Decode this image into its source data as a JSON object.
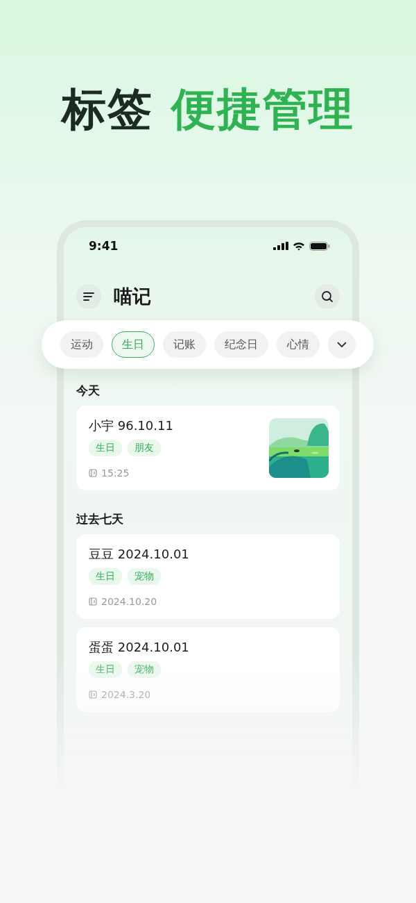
{
  "headline": [
    {
      "text": "标签",
      "kind": "dark"
    },
    {
      "text": "便捷管理",
      "kind": "accent"
    }
  ],
  "status_bar": {
    "time": "9:41"
  },
  "app_bar": {
    "title": "喵记"
  },
  "tag_filter": {
    "tags": [
      {
        "label": "运动",
        "selected": false
      },
      {
        "label": "生日",
        "selected": true
      },
      {
        "label": "记账",
        "selected": false
      },
      {
        "label": "纪念日",
        "selected": false
      },
      {
        "label": "心情",
        "selected": false
      }
    ]
  },
  "sections": [
    {
      "heading": "今天",
      "entries": [
        {
          "title": "小宇 96.10.11",
          "tags": [
            "生日",
            "朋友"
          ],
          "time": "15:25"
        }
      ]
    },
    {
      "heading": "过去七天",
      "entries": [
        {
          "title": "豆豆 2024.10.01",
          "tags": [
            "生日",
            "宠物"
          ],
          "time": "2024.10.20"
        },
        {
          "title": "蛋蛋 2024.10.01",
          "tags": [
            "生日",
            "宠物"
          ],
          "time": "2024.3.20"
        }
      ]
    }
  ]
}
